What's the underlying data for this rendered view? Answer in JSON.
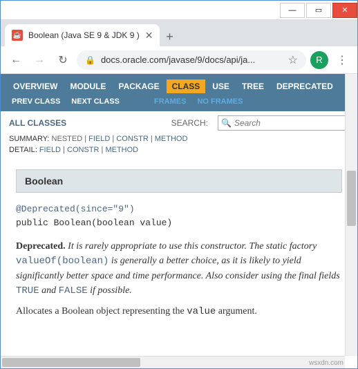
{
  "window": {
    "min": "—",
    "max": "▭",
    "close": "✕"
  },
  "browser": {
    "tab_title": "Boolean (Java SE 9 & JDK 9 )",
    "tab_favicon": "☕",
    "new_tab": "+",
    "tab_close": "✕",
    "back": "←",
    "forward": "→",
    "reload": "↻",
    "lock": "🔒",
    "url": "docs.oracle.com/javase/9/docs/api/ja...",
    "star": "☆",
    "avatar": "R",
    "menu": "⋮"
  },
  "nav": {
    "items": [
      {
        "label": "OVERVIEW"
      },
      {
        "label": "MODULE"
      },
      {
        "label": "PACKAGE"
      },
      {
        "label": "CLASS",
        "active": true
      },
      {
        "label": "USE"
      },
      {
        "label": "TREE"
      },
      {
        "label": "DEPRECATED"
      }
    ],
    "row2": {
      "prev": "PREV CLASS",
      "next": "NEXT CLASS",
      "frames": "FRAMES",
      "noframes": "NO FRAMES"
    }
  },
  "sub": {
    "all_classes": "ALL CLASSES",
    "search_label": "SEARCH:",
    "search_placeholder": "Search",
    "search_icon": "🔍",
    "clear": "✕",
    "summary_label": "SUMMARY:",
    "summary_items": [
      "NESTED",
      "FIELD",
      "CONSTR",
      "METHOD"
    ],
    "detail_label": "DETAIL:",
    "detail_items": [
      "FIELD",
      "CONSTR",
      "METHOD"
    ]
  },
  "doc": {
    "header": "Boolean",
    "annotation": "@Deprecated(since=\"9\")",
    "signature": "public Boolean(boolean value)",
    "deprecated_hdr": "Deprecated.",
    "deprecated_text1": " It is rarely appropriate to use this constructor. The static factory ",
    "deprecated_code1": "valueOf(boolean)",
    "deprecated_text2": " is generally a better choice, as it is likely to yield significantly better space and time performance. Also consider using the final fields ",
    "deprecated_code2": "TRUE",
    "deprecated_text3": " and ",
    "deprecated_code3": "FALSE",
    "deprecated_text4": " if possible.",
    "desc1": "Allocates a Boolean object representing the ",
    "desc_code": "value",
    "desc2": " argument."
  },
  "watermark": "wsxdn.com"
}
